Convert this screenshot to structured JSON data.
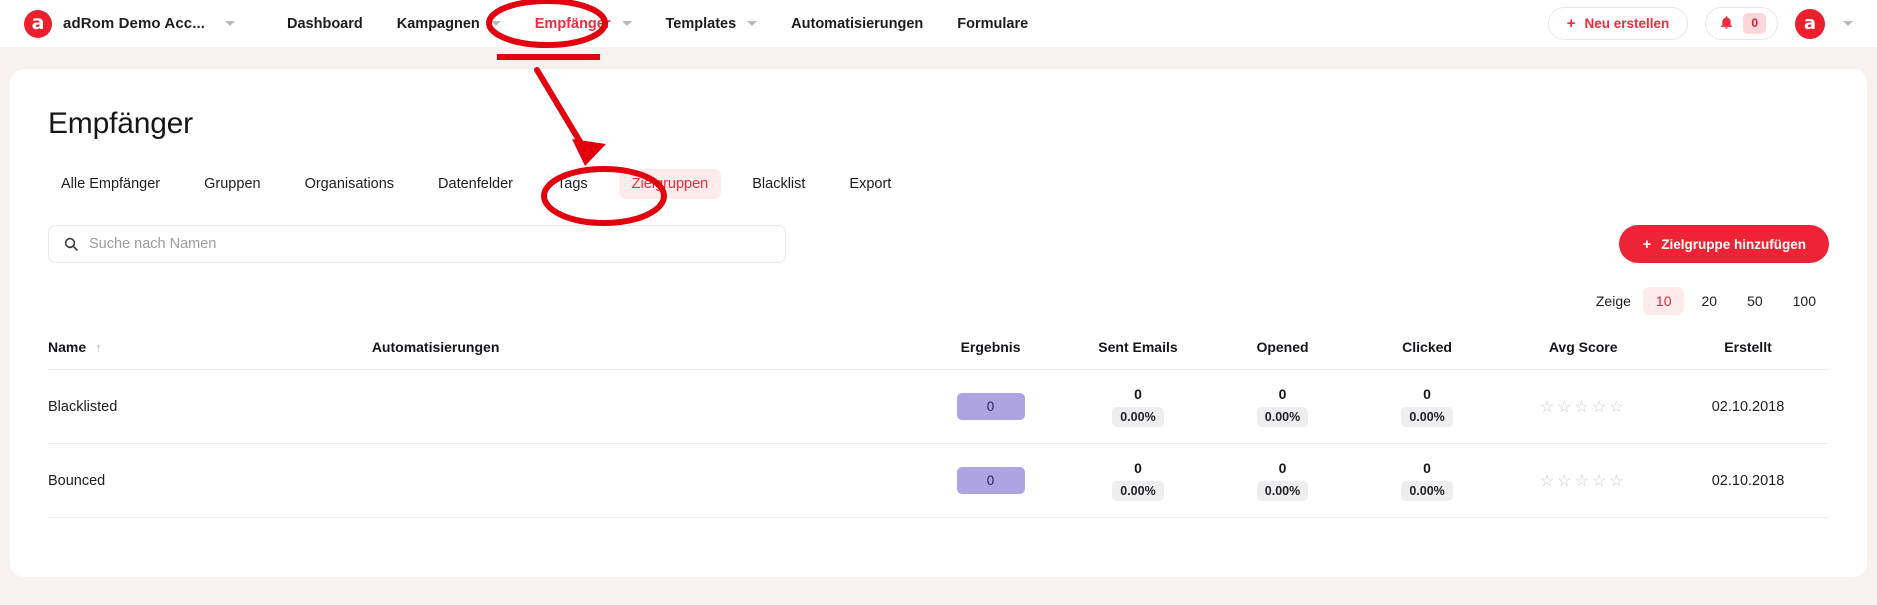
{
  "navbar": {
    "brand": {
      "logo_glyph": "a",
      "name": "adRom Demo Acc...",
      "icon": "brand-logo-icon"
    },
    "items": [
      {
        "label": "Dashboard",
        "has_caret": false,
        "active": false
      },
      {
        "label": "Kampagnen",
        "has_caret": true,
        "active": false
      },
      {
        "label": "Empfänger",
        "has_caret": true,
        "active": true
      },
      {
        "label": "Templates",
        "has_caret": true,
        "active": false
      },
      {
        "label": "Automatisierungen",
        "has_caret": false,
        "active": false
      },
      {
        "label": "Formulare",
        "has_caret": false,
        "active": false
      }
    ],
    "create_button": {
      "label": "Neu erstellen",
      "plus": "+"
    },
    "notifications": {
      "count": "0",
      "icon": "bell-icon"
    },
    "avatar": {
      "glyph": "a"
    }
  },
  "page": {
    "title": "Empfänger"
  },
  "tabs": [
    {
      "label": "Alle Empfänger",
      "active": false
    },
    {
      "label": "Gruppen",
      "active": false
    },
    {
      "label": "Organisations",
      "active": false
    },
    {
      "label": "Datenfelder",
      "active": false
    },
    {
      "label": "Tags",
      "active": false
    },
    {
      "label": "Zielgruppen",
      "active": true
    },
    {
      "label": "Blacklist",
      "active": false
    },
    {
      "label": "Export",
      "active": false
    }
  ],
  "search": {
    "placeholder": "Suche nach Namen",
    "value": "",
    "icon": "search-icon"
  },
  "add_button": {
    "label": "Zielgruppe hinzufügen",
    "plus": "+"
  },
  "pagesize": {
    "label": "Zeige",
    "options": [
      "10",
      "20",
      "50",
      "100"
    ],
    "selected": "10"
  },
  "table": {
    "columns": [
      {
        "label": "Name",
        "sort_arrow": "↑",
        "align": "left"
      },
      {
        "label": "Automatisierungen",
        "align": "left"
      },
      {
        "label": "Ergebnis",
        "align": "center"
      },
      {
        "label": "Sent Emails",
        "align": "center"
      },
      {
        "label": "Opened",
        "align": "center"
      },
      {
        "label": "Clicked",
        "align": "center"
      },
      {
        "label": "Avg Score",
        "align": "center"
      },
      {
        "label": "Erstellt",
        "align": "center"
      }
    ],
    "rows": [
      {
        "name": "Blacklisted",
        "automatisierungen": "",
        "ergebnis": "0",
        "sent_emails": {
          "value": "0",
          "pct": "0.00%"
        },
        "opened": {
          "value": "0",
          "pct": "0.00%"
        },
        "clicked": {
          "value": "0",
          "pct": "0.00%"
        },
        "avg_score": "☆☆☆☆☆",
        "erstellt": "02.10.2018"
      },
      {
        "name": "Bounced",
        "automatisierungen": "",
        "ergebnis": "0",
        "sent_emails": {
          "value": "0",
          "pct": "0.00%"
        },
        "opened": {
          "value": "0",
          "pct": "0.00%"
        },
        "clicked": {
          "value": "0",
          "pct": "0.00%"
        },
        "avg_score": "☆☆☆☆☆",
        "erstellt": "02.10.2018"
      }
    ]
  },
  "colors": {
    "brand_red": "#ee2436",
    "accent_light": "#fdeceb",
    "page_bg": "#f7f1ef",
    "chip_purple": "#aea4e3",
    "annotation_red": "#e2000f"
  }
}
